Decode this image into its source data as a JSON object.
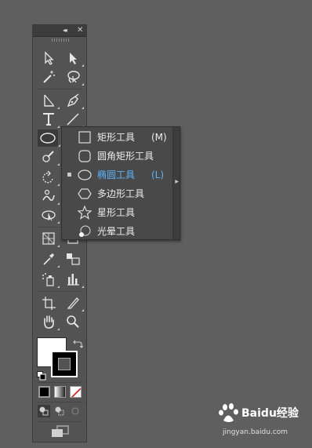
{
  "toolbar": {
    "collapse_glyph": "◂◂",
    "close_glyph": "✕",
    "tools": [
      "selection-tool",
      "direct-selection-tool",
      "magic-wand-tool",
      "lasso-tool",
      "line-segment-angle-tool",
      "pen-tool",
      "type-tool",
      "line-tool",
      "ellipse-tool",
      "pencil-tool",
      "blob-brush-tool",
      "eraser-tool",
      "rotate-tool",
      "scale-tool",
      "warp-tool",
      "free-transform-tool",
      "symbol-sprayer-tool",
      "column-graph-tool",
      "artboard-tool",
      "slice-tool",
      "hand-tool",
      "zoom-tool"
    ],
    "fill_color": "#ffffff",
    "stroke_color": "#000000"
  },
  "flyout": {
    "items": [
      {
        "label": "矩形工具",
        "shortcut": "(M)",
        "icon": "rectangle-icon"
      },
      {
        "label": "圆角矩形工具",
        "shortcut": "",
        "icon": "rounded-rectangle-icon"
      },
      {
        "label": "椭圆工具",
        "shortcut": "(L)",
        "icon": "ellipse-icon",
        "selected": true
      },
      {
        "label": "多边形工具",
        "shortcut": "",
        "icon": "polygon-icon"
      },
      {
        "label": "星形工具",
        "shortcut": "",
        "icon": "star-icon"
      },
      {
        "label": "光晕工具",
        "shortcut": "",
        "icon": "flare-icon"
      }
    ],
    "highlight_color": "#5ab4ff"
  },
  "watermark": {
    "brand": "Baidu经验",
    "url": "jingyan.baidu.com"
  }
}
